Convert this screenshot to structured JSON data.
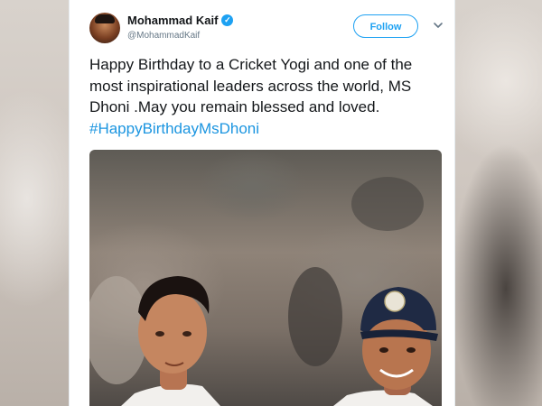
{
  "tweet": {
    "display_name": "Mohammad Kaif",
    "handle": "@MohammadKaif",
    "follow_label": "Follow",
    "verified_glyph": "✓",
    "text_main": "Happy Birthday to a Cricket Yogi and one of the most inspirational leaders across the world, MS Dhoni .May you remain blessed and loved. ",
    "hashtag": "#HappyBirthdayMsDhoni"
  },
  "icons": {
    "verified": "verified-badge-icon",
    "menu": "chevron-down-icon"
  },
  "colors": {
    "accent": "#1da1f2",
    "hashtag": "#1b95e0",
    "text": "#14171a",
    "muted": "#657786"
  }
}
